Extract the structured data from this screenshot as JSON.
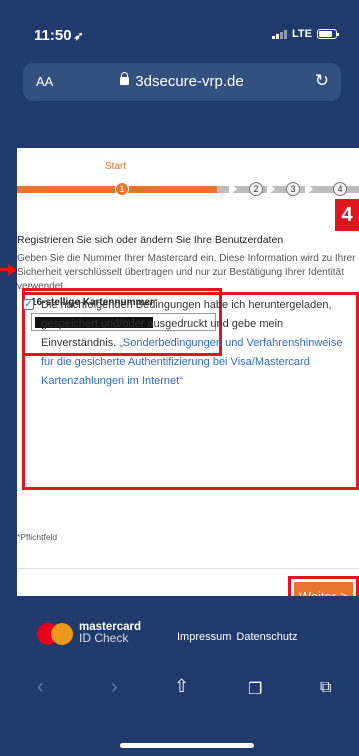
{
  "status_bar": {
    "time": "11:50",
    "network": "LTE"
  },
  "browser": {
    "text_size_button": "AA",
    "url": "3dsecure-vrp.de"
  },
  "progress": {
    "current_label": "Start",
    "steps": [
      "1",
      "2",
      "3",
      "4"
    ]
  },
  "form": {
    "heading": "Registrieren Sie sich oder ändern Sie Ihre Benutzerdaten",
    "intro": "Geben Sie die Nummer Ihrer Mastercard ein. Diese Information wird zu Ihrer Sicherheit verschlüsselt übertragen und nur zur Bestätigung Ihrer Identität verwendet.",
    "card_label": "16-stellige Kartennummer",
    "required_mark": "*",
    "terms_text": "Die nachfolgenden Bedingungen habe ich heruntergeladen, gespeichert und/oder ausgedruckt und gebe mein Einverständnis. ",
    "terms_link": "„Sonderbedingungen und Verfahrenshinweise für die gesicherte Authentifizierung bei Visa/Mastercard Kartenzahlungen im Internet“",
    "terms_checked": true,
    "mandatory_note": "*Pflichtfeld",
    "submit_label": "Weiter",
    "submit_arrow": ">"
  },
  "annotation": {
    "step_badge": "4"
  },
  "footer": {
    "brand_line1": "mastercard",
    "brand_line2": "ID Check",
    "link_impressum": "Impressum",
    "link_datenschutz": "Datenschutz"
  },
  "colors": {
    "chrome": "#1f3a6b",
    "accent": "#e8742d",
    "highlight": "#e01520",
    "link": "#2f6cc0"
  }
}
